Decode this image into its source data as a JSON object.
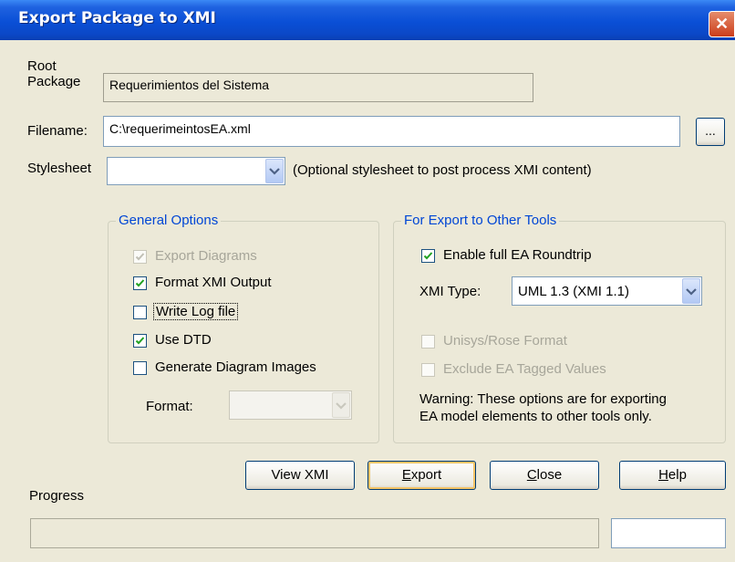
{
  "window": {
    "title": "Export Package to XMI",
    "close_glyph": "✕"
  },
  "root_package": {
    "label_line1": "Root",
    "label_line2": "Package",
    "value": "Requerimientos del Sistema"
  },
  "filename": {
    "label": "Filename:",
    "value": "C:\\requerimeintosEA.xml",
    "browse_label": "..."
  },
  "stylesheet": {
    "label": "Stylesheet",
    "value": "",
    "hint": "(Optional stylesheet to post process XMI content)"
  },
  "general_options": {
    "title": "General Options",
    "export_diagrams": {
      "label": "Export Diagrams",
      "checked": true,
      "disabled": true
    },
    "format_xmi_output": {
      "label": "Format XMI Output",
      "checked": true
    },
    "write_log_file": {
      "label": "Write Log file",
      "checked": false
    },
    "use_dtd": {
      "label": "Use DTD",
      "checked": true
    },
    "generate_diagram_images": {
      "label": "Generate Diagram Images",
      "checked": false
    },
    "format_label": "Format:",
    "format_value": ""
  },
  "other_tools": {
    "title": "For Export to Other Tools",
    "enable_roundtrip": {
      "label": "Enable full EA Roundtrip",
      "checked": true
    },
    "xmi_type_label": "XMI Type:",
    "xmi_type_value": "UML 1.3 (XMI 1.1)",
    "unisys_rose": {
      "label": "Unisys/Rose Format",
      "checked": false,
      "disabled": true
    },
    "exclude_tagged": {
      "label": "Exclude EA Tagged Values",
      "checked": false,
      "disabled": true
    },
    "warning_line1": "Warning: These options are for exporting",
    "warning_line2": "EA model elements to other tools only."
  },
  "buttons": {
    "view_xmi": "View XMI",
    "export_first": "E",
    "export_rest": "xport",
    "close_first": "C",
    "close_rest": "lose",
    "help_first": "H",
    "help_rest": "elp"
  },
  "progress": {
    "label": "Progress",
    "value": 0
  },
  "colors": {
    "title_bar": "#0a4fd6",
    "group_title": "#0046d5",
    "dialog_bg": "#ece9d8"
  },
  "icons": {
    "close": "close-icon",
    "dropdown": "chevron-down-icon",
    "check": "check-icon"
  }
}
